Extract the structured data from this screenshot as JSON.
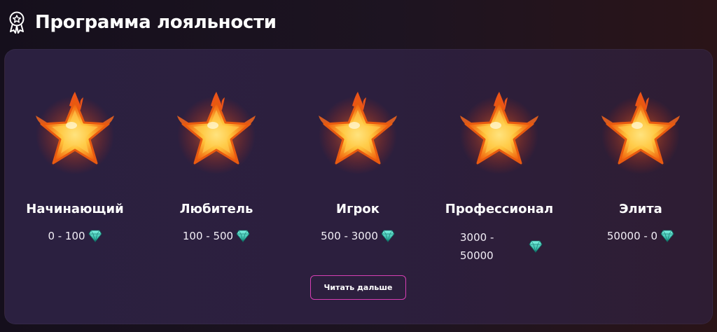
{
  "header": {
    "title": "Программа лояльности",
    "icon": "medal-star-icon"
  },
  "levels": [
    {
      "name": "Начинающий",
      "range": "0 - 100",
      "icon": "fire-star-icon",
      "currency_icon": "diamond-icon"
    },
    {
      "name": "Любитель",
      "range": "100 - 500",
      "icon": "fire-star-icon",
      "currency_icon": "diamond-icon"
    },
    {
      "name": "Игрок",
      "range": "500 - 3000",
      "icon": "fire-star-icon",
      "currency_icon": "diamond-icon"
    },
    {
      "name": "Профессионал",
      "range": "3000 -\n50000",
      "icon": "fire-star-icon",
      "currency_icon": "diamond-icon"
    },
    {
      "name": "Элита",
      "range": "50000 - 0",
      "icon": "fire-star-icon",
      "currency_icon": "diamond-icon"
    }
  ],
  "read_more_label": "Читать дальше",
  "colors": {
    "accent": "#d63fb4",
    "gem": "#3fd3c0",
    "panel": "#2b2040",
    "background": "#150f1c"
  }
}
